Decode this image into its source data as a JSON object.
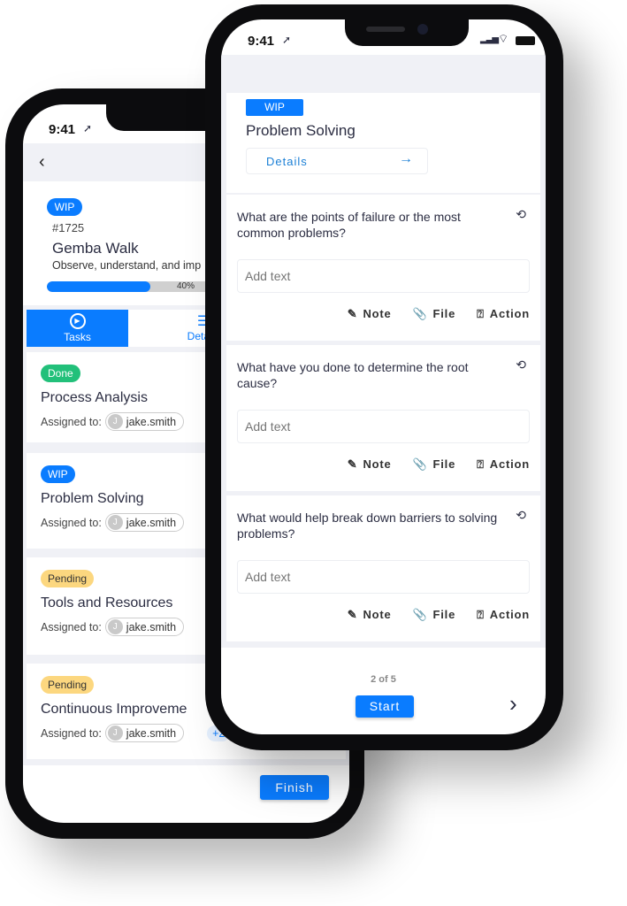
{
  "colors": {
    "primary": "#0a7cff",
    "done": "#22c07a",
    "pending": "#fcd77f",
    "background": "#f0f1f6"
  },
  "left_phone": {
    "status_time": "9:41",
    "back_icon": "chevron-left-icon",
    "header": {
      "status": "WIP",
      "number": "#1725",
      "title": "Gemba Walk",
      "subtitle": "Observe, understand, and imp",
      "progress_percent": 40,
      "progress_label": "40%"
    },
    "tabs": [
      {
        "label": "Tasks",
        "icon": "play-circle-icon",
        "active": true
      },
      {
        "label": "Details",
        "icon": "list-icon",
        "active": false
      }
    ],
    "tasks": [
      {
        "status": "Done",
        "title": "Process Analysis",
        "assigned_label": "Assigned to:",
        "avatar": "J",
        "assignee": "jake.smith"
      },
      {
        "status": "WIP",
        "title": "Problem Solving",
        "assigned_label": "Assigned to:",
        "avatar": "J",
        "assignee": "jake.smith"
      },
      {
        "status": "Pending",
        "title": "Tools and Resources",
        "assigned_label": "Assigned to:",
        "avatar": "J",
        "assignee": "jake.smith"
      },
      {
        "status": "Pending",
        "title": "Continuous Improveme",
        "assigned_label": "Assigned to:",
        "avatar": "J",
        "assignee": "jake.smith",
        "extra": "+2"
      }
    ],
    "finish_label": "Finish"
  },
  "right_phone": {
    "status_time": "9:41",
    "task": {
      "status": "WIP",
      "title": "Problem Solving",
      "details_label": "Details"
    },
    "questions": [
      {
        "text": "What are the points of failure or the most common problems?",
        "placeholder": "Add text"
      },
      {
        "text": "What have you done to determine the root cause?",
        "placeholder": "Add text"
      },
      {
        "text": "What would help break down barriers to solving problems?",
        "placeholder": "Add text"
      }
    ],
    "actions": {
      "note": "Note",
      "file": "File",
      "action": "Action"
    },
    "pager": "2 of 5",
    "start_label": "Start"
  }
}
